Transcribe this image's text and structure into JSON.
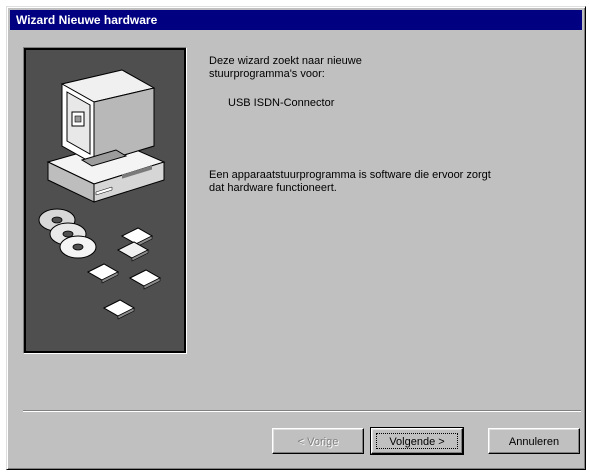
{
  "window": {
    "title": "Wizard Nieuwe hardware"
  },
  "content": {
    "intro_line1": "Deze wizard zoekt naar nieuwe",
    "intro_line2": "stuurprogramma's voor:",
    "device_name": "USB ISDN-Connector",
    "description_line1": "Een apparaatstuurprogramma is software die ervoor zorgt",
    "description_line2": "dat hardware functioneert."
  },
  "buttons": {
    "back_label": "< Vorige",
    "next_label": "Volgende >",
    "cancel_label": "Annuleren"
  },
  "colors": {
    "titlebar": "#000080",
    "dialog_background": "#c0c0c0",
    "side_panel": "#4f4f4f"
  },
  "icons": {
    "side_panel": [
      "computer-icon",
      "cd-disc-icon",
      "floppy-disk-icon"
    ]
  }
}
